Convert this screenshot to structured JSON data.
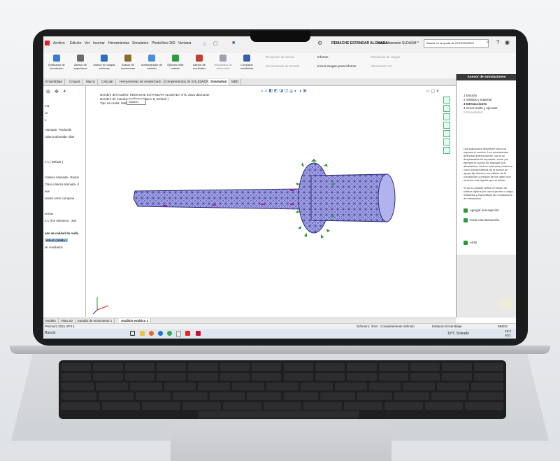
{
  "app": {
    "document_title": "REMACHE ESTANDAR ALOMADA",
    "document_sub": "clavo diamante SLDASM *",
    "search_placeholder": "Buscar en la ayuda de SOLIDWORKS"
  },
  "menu": [
    "Archivo",
    "Edición",
    "Ver",
    "Insertar",
    "Herramientas",
    "Simulation",
    "PhotoView 360",
    "Ventana"
  ],
  "ribbon": {
    "buttons": [
      {
        "label": "Evaluador de simulación",
        "icon": "evaluator-icon",
        "color": "#3a7bd5"
      },
      {
        "label": "Asesor de sujeciones",
        "icon": "fixture-icon",
        "color": "#6b6b6b"
      },
      {
        "label": "Asesor de cargas externas",
        "icon": "load-icon",
        "color": "#2b6fb8"
      },
      {
        "label": "Asesor de conexiones",
        "icon": "connection-icon",
        "color": "#8a6b2b"
      },
      {
        "label": "Administrador de vaciado",
        "icon": "shell-icon",
        "color": "#4b8fd8"
      },
      {
        "label": "Ejecutar este estudio",
        "icon": "run-icon",
        "color": "#2e9b3e"
      },
      {
        "label": "Asesor de resultados",
        "icon": "results-icon",
        "color": "#c2402f"
      },
      {
        "label": "Resultados de deformada",
        "icon": "deformed-icon",
        "color": "#9aa3b0"
      },
      {
        "label": "Comparar resultados",
        "icon": "compare-icon",
        "color": "#3a5fa8"
      }
    ],
    "right": [
      {
        "label": "Recepción de diseño"
      },
      {
        "label": "Herramientas de trazado"
      },
      {
        "label": "Informe"
      },
      {
        "label": "Incluir imagen para informe"
      },
      {
        "label": "Simulación de cargas"
      },
      {
        "label": "Administrar red"
      }
    ]
  },
  "tabs": [
    "Ensamblaje",
    "Croquis",
    "Marca",
    "Calcular",
    "Herramientas de renderizado",
    "Complementos de SOLIDWORKS",
    "Simulation",
    "MBD"
  ],
  "tabs_active": "Simulation",
  "tree": [
    "rna",
    "ce",
    "e",
    "Alomada - Redonde",
    "cabeza alomada- dian",
    "o 1 ( Default )",
    "Cabeza Alomada - Redon",
    "Clavo cabeza alomada- d",
    "nes",
    "xiones entre compone",
    "ternas",
    "o 1 (Por elemento - 300",
    "ado de calidad de malla",
    "stica1 ( Malla )",
    "de resultados"
  ],
  "tree_selected": "stica1 ( Malla )",
  "viewport": {
    "line1": "Nombre del modelo: REMACHE ESTANDAR ALOMADA XTL clavo diamante",
    "line2": "Nombre de estudio: Análisis estático 1( Default )",
    "line3": "Tipo de malla: Malla sólida",
    "popup": "Sketch1"
  },
  "advisor": {
    "title": "Asesor de simulaciones",
    "steps": [
      "1 Estudio",
      "2 Sólidos y material",
      "3 Interacciones",
      "4 Crear malla y ejecutar",
      "5 Resultados"
    ],
    "active_step": "3 Interacciones",
    "body1": "Las sujeciones describen cómo se soporta el modelo. Los movimientos definidos anteriormente, como un desplazamiento impuesto, como por ejemplo la acción de empujar una abrazadera. Ambos extremos producen como consecuencia de la acción de apoyo fijo bierra y los sólidos de la conducción y presión de los datos son muchos más rígidos que el sólido.",
    "body2": "Si no es posible definir el efecto de sólidos rígidos por una sujeción o carga, instálelos y especifique las condiciones de interacción.",
    "links": [
      "Agregar una sujeción.",
      "Crear una interacción."
    ],
    "back": "Atrás"
  },
  "bottom_tabs": [
    "Modelo",
    "Vista 3D",
    "Estudio de movimiento 1",
    "Análisis estático 1"
  ],
  "bottom_active": "Análisis estático 1",
  "status": {
    "left": "Premium 2021 SP3.1",
    "diameter": "Diámetro: 3mm",
    "defined": "Completamente definido",
    "editing": "Editando Ensamblaje",
    "units": "MMGS"
  },
  "taskbar": {
    "search": "Buscar",
    "weather": "19°C  Soleado",
    "time": "19:2",
    "date": "20/1"
  },
  "colors": {
    "accent": "#3a7bd5",
    "mesh_fill": "#9d9ee4",
    "mesh_line": "#2d2f7a",
    "fixture_green": "#2c9a2c",
    "load_magenta": "#b020b0"
  }
}
